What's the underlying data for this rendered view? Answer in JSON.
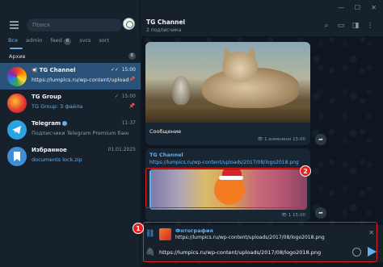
{
  "sidebar": {
    "search_placeholder": "Поиск",
    "folders": [
      {
        "label": "Все",
        "count": ""
      },
      {
        "label": "admin",
        "count": ""
      },
      {
        "label": "feed",
        "count": "6"
      },
      {
        "label": "svcs",
        "count": ""
      },
      {
        "label": "sort",
        "count": ""
      }
    ],
    "archive_label": "Архив",
    "archive_count": "8",
    "chats": [
      {
        "name": "TG Channel",
        "time": "15:00",
        "preview": "https://lumpics.ru/wp-content/uploads/..."
      },
      {
        "name": "TG Group",
        "time": "15:00",
        "preview": "TG Group: 3 файла"
      },
      {
        "name": "Telegram",
        "time": "11:37",
        "preview": "Подписчики Telegram Premium банк..."
      },
      {
        "name": "Избранное",
        "time": "01.01.2025",
        "preview": "documents lock.zip"
      }
    ]
  },
  "window": {
    "min": "—",
    "max": "☐",
    "close": "✕"
  },
  "header": {
    "title": "TG Channel",
    "subtitle": "2 подписчика"
  },
  "messages": {
    "photo_caption": "Сообщение",
    "photo_meta": "1 изменено 15:00",
    "link_title": "TG Channel",
    "link_url": "https://lumpics.ru/wp-content/uploads/2017/08/logo2018.png",
    "link_meta": "1 15:00"
  },
  "reply": {
    "title": "Фотография",
    "text": "https://lumpics.ru/wp-content/uploads/2017/08/logo2018.png"
  },
  "composer": {
    "text": "https://lumpics.ru/wp-content/uploads/2017/08/logo2018.png"
  },
  "annotations": {
    "badge1": "1",
    "badge2": "2"
  },
  "colors": {
    "accent": "#5fb0f2",
    "highlight": "#e42020",
    "active_chat": "#2b5278"
  }
}
